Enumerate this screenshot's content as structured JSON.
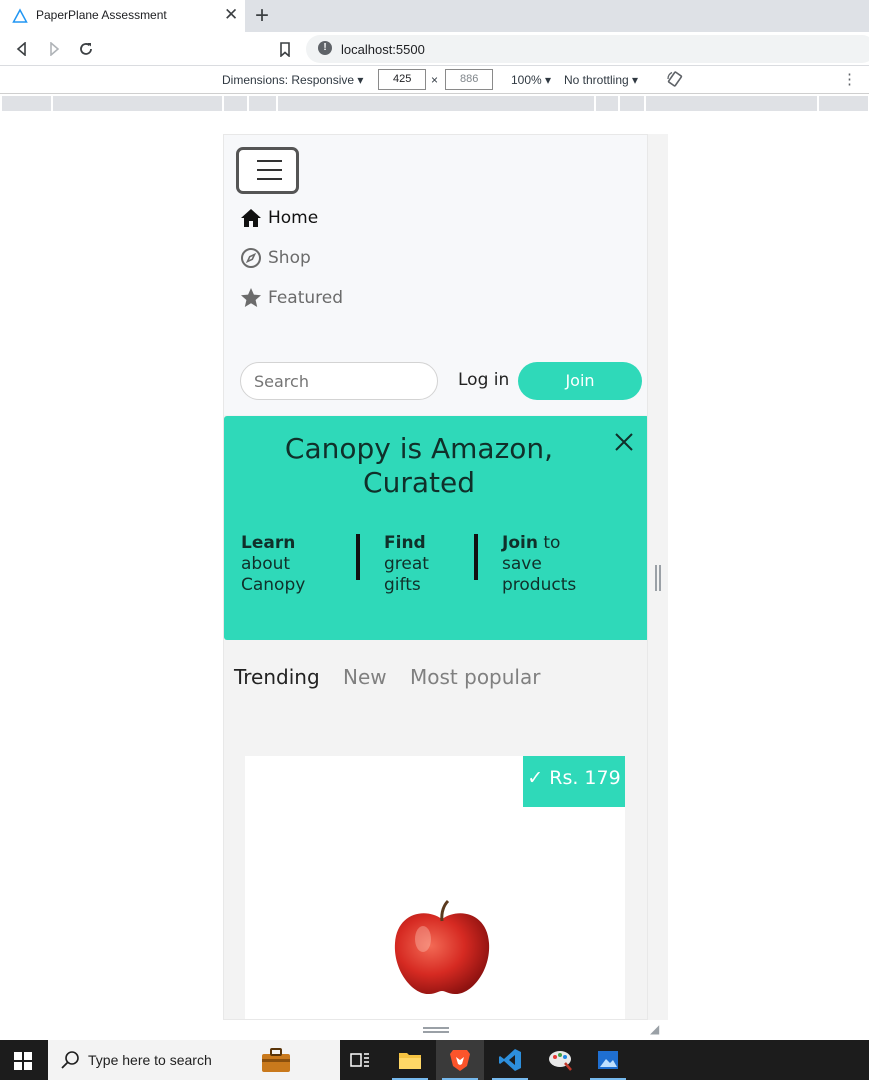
{
  "browser": {
    "tab_title": "PaperPlane Assessment",
    "tab_close": "✕",
    "new_tab": "+",
    "url": "localhost:5500"
  },
  "devtools": {
    "dimensions_label": "Dimensions: Responsive ▾",
    "width": "425",
    "times": "×",
    "height": "886",
    "zoom": "100% ▾",
    "throttling": "No throttling ▾"
  },
  "site": {
    "menu": [
      {
        "label": "Home",
        "icon": "home-icon"
      },
      {
        "label": "Shop",
        "icon": "compass-icon"
      },
      {
        "label": "Featured",
        "icon": "star-icon"
      }
    ],
    "search_placeholder": "Search",
    "login_label": "Log in",
    "join_label": "Join",
    "accent_color": "#2fd9b9",
    "banner": {
      "headline": "Canopy is Amazon, Curated",
      "features": [
        {
          "bold": "Learn",
          "rest": "about Canopy"
        },
        {
          "bold": "Find",
          "rest": "great gifts"
        },
        {
          "bold": "Join",
          "rest": "to save products"
        }
      ]
    },
    "tabs": [
      {
        "label": "Trending",
        "active": true
      },
      {
        "label": "New",
        "active": false
      },
      {
        "label": "Most popular",
        "active": false
      }
    ],
    "product": {
      "price": "✓ Rs. 179",
      "image": "apple"
    }
  },
  "taskbar": {
    "search_placeholder": "Type here to search",
    "apps": [
      "briefcase-icon",
      "task-view-icon",
      "file-explorer-icon",
      "brave-browser-icon",
      "vscode-icon",
      "paint-icon",
      "photos-icon"
    ]
  }
}
